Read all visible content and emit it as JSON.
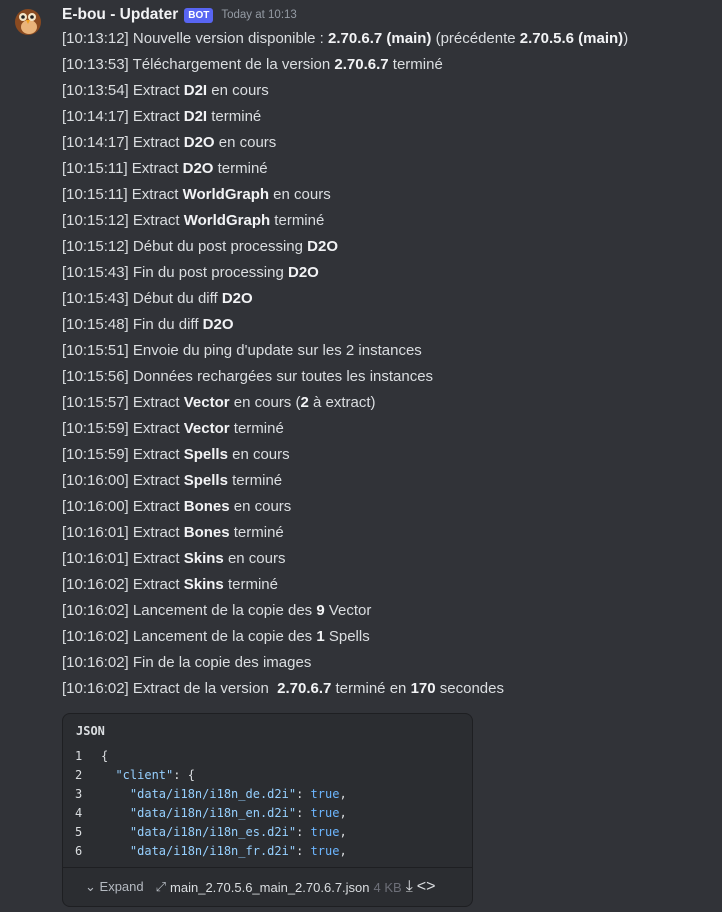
{
  "author": {
    "name": "E-bou - Updater",
    "badge": "BOT",
    "timestamp": "Today at 10:13"
  },
  "lines": [
    [
      {
        "t": "[10:13:12] Nouvelle version disponible : "
      },
      {
        "t": "2.70.6.7 (main)",
        "b": 1
      },
      {
        "t": " (précédente "
      },
      {
        "t": "2.70.5.6 (main)",
        "b": 1
      },
      {
        "t": ")"
      }
    ],
    [
      {
        "t": "[10:13:53] Téléchargement de la version "
      },
      {
        "t": "2.70.6.7",
        "b": 1
      },
      {
        "t": " terminé"
      }
    ],
    [
      {
        "t": "[10:13:54] Extract "
      },
      {
        "t": "D2I",
        "b": 1
      },
      {
        "t": " en cours"
      }
    ],
    [
      {
        "t": "[10:14:17] Extract "
      },
      {
        "t": "D2I",
        "b": 1
      },
      {
        "t": " terminé"
      }
    ],
    [
      {
        "t": "[10:14:17] Extract "
      },
      {
        "t": "D2O",
        "b": 1
      },
      {
        "t": " en cours"
      }
    ],
    [
      {
        "t": "[10:15:11] Extract "
      },
      {
        "t": "D2O",
        "b": 1
      },
      {
        "t": " terminé"
      }
    ],
    [
      {
        "t": "[10:15:11] Extract "
      },
      {
        "t": "WorldGraph",
        "b": 1
      },
      {
        "t": " en cours"
      }
    ],
    [
      {
        "t": "[10:15:12] Extract "
      },
      {
        "t": "WorldGraph",
        "b": 1
      },
      {
        "t": " terminé"
      }
    ],
    [
      {
        "t": "[10:15:12] Début du post processing "
      },
      {
        "t": "D2O",
        "b": 1
      }
    ],
    [
      {
        "t": "[10:15:43] Fin du post processing "
      },
      {
        "t": "D2O",
        "b": 1
      }
    ],
    [
      {
        "t": "[10:15:43] Début du diff "
      },
      {
        "t": "D2O",
        "b": 1
      }
    ],
    [
      {
        "t": "[10:15:48] Fin du diff "
      },
      {
        "t": "D2O",
        "b": 1
      }
    ],
    [
      {
        "t": "[10:15:51] Envoie du ping d'update sur les 2 instances"
      }
    ],
    [
      {
        "t": "[10:15:56] Données rechargées sur toutes les instances"
      }
    ],
    [
      {
        "t": "[10:15:57] Extract "
      },
      {
        "t": "Vector",
        "b": 1
      },
      {
        "t": " en cours ("
      },
      {
        "t": "2",
        "b": 1
      },
      {
        "t": " à extract)"
      }
    ],
    [
      {
        "t": "[10:15:59] Extract "
      },
      {
        "t": "Vector",
        "b": 1
      },
      {
        "t": " terminé"
      }
    ],
    [
      {
        "t": "[10:15:59] Extract "
      },
      {
        "t": "Spells",
        "b": 1
      },
      {
        "t": " en cours"
      }
    ],
    [
      {
        "t": "[10:16:00] Extract "
      },
      {
        "t": "Spells",
        "b": 1
      },
      {
        "t": " terminé"
      }
    ],
    [
      {
        "t": "[10:16:00] Extract "
      },
      {
        "t": "Bones",
        "b": 1
      },
      {
        "t": " en cours"
      }
    ],
    [
      {
        "t": "[10:16:01] Extract "
      },
      {
        "t": "Bones",
        "b": 1
      },
      {
        "t": " terminé"
      }
    ],
    [
      {
        "t": "[10:16:01] Extract "
      },
      {
        "t": "Skins",
        "b": 1
      },
      {
        "t": " en cours"
      }
    ],
    [
      {
        "t": "[10:16:02] Extract "
      },
      {
        "t": "Skins",
        "b": 1
      },
      {
        "t": " terminé"
      }
    ],
    [
      {
        "t": "[10:16:02] Lancement de la copie des "
      },
      {
        "t": "9",
        "b": 1
      },
      {
        "t": " Vector"
      }
    ],
    [
      {
        "t": "[10:16:02] Lancement de la copie des "
      },
      {
        "t": "1",
        "b": 1
      },
      {
        "t": " Spells"
      }
    ],
    [
      {
        "t": "[10:16:02] Fin de la copie des images"
      }
    ],
    [
      {
        "t": "[10:16:02] Extract de la version  "
      },
      {
        "t": "2.70.6.7",
        "b": 1
      },
      {
        "t": " terminé en "
      },
      {
        "t": "170",
        "b": 1
      },
      {
        "t": " secondes"
      }
    ]
  ],
  "attachment": {
    "language": "JSON",
    "code": [
      {
        "n": "1",
        "indent": "",
        "key": "",
        "val": "{"
      },
      {
        "n": "2",
        "indent": "  ",
        "key": "\"client\"",
        "val": ": {"
      },
      {
        "n": "3",
        "indent": "    ",
        "key": "\"data/i18n/i18n_de.d2i\"",
        "val": "true"
      },
      {
        "n": "4",
        "indent": "    ",
        "key": "\"data/i18n/i18n_en.d2i\"",
        "val": "true"
      },
      {
        "n": "5",
        "indent": "    ",
        "key": "\"data/i18n/i18n_es.d2i\"",
        "val": "true"
      },
      {
        "n": "6",
        "indent": "    ",
        "key": "\"data/i18n/i18n_fr.d2i\"",
        "val": "true"
      }
    ],
    "expand_label": "Expand",
    "filename": "main_2.70.5.6_main_2.70.6.7.json",
    "size": "4 KB"
  },
  "colors": {
    "background": "#313338",
    "bot_badge": "#5865f2",
    "code_bg": "#2b2d31"
  }
}
